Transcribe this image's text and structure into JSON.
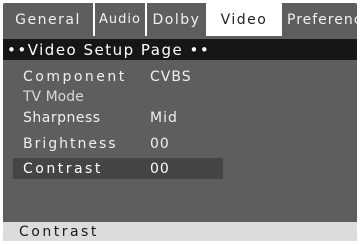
{
  "tabs": [
    {
      "label": "General",
      "active": false
    },
    {
      "label": "Audio",
      "active": false
    },
    {
      "label": "Dolby",
      "active": false
    },
    {
      "label": "Video",
      "active": true
    },
    {
      "label": "Preference",
      "active": false
    }
  ],
  "page_title": "••Video Setup Page ••",
  "settings": [
    {
      "label": "Component",
      "value": "CVBS"
    },
    {
      "label": "TV Mode",
      "value": ""
    },
    {
      "label": "Sharpness",
      "value": "Mid"
    },
    {
      "label": "Brightness",
      "value": "00"
    },
    {
      "label": "Contrast",
      "value": "00",
      "selected": true
    }
  ],
  "status_text": "Contrast",
  "colors": {
    "panel_background": "#5e5e5e",
    "title_bar": "#161616",
    "active_tab": "#ffffff",
    "selected_row": "#454545",
    "status_bar": "#dcdcdc",
    "text": "#f0f0f0"
  }
}
